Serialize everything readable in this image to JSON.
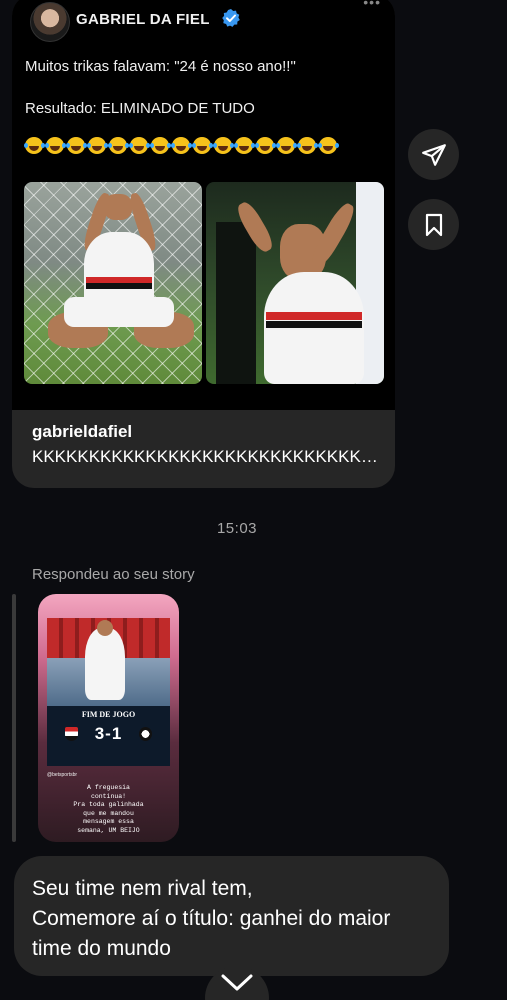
{
  "shared_post": {
    "author_name": "GABRIEL DA FIEL",
    "verified": true,
    "text_line1": "Muitos trikas falavam: \"24 é nosso ano!!\"",
    "text_line2": "Resultado: ELIMINADO DE TUDO",
    "emoji_icon": "laughing-tears-emoji",
    "emoji_count": 15,
    "username": "gabrieldafiel",
    "caption": "KKKKKKKKKKKKKKKKKKKKKKKKKKKKKKKKK"
  },
  "actions": {
    "share_icon": "send-icon",
    "save_icon": "bookmark-icon"
  },
  "timestamp": "15:03",
  "story_reply": {
    "label": "Respondeu ao seu story",
    "story": {
      "headline": "FIM DE JOGO",
      "score": "3-1",
      "handle": "@betsportsbr",
      "caption": "A freguesia\ncontinua!\nPra toda galinhada\nque me mandou\nmensagem essa\nsemana, UM BEIJO"
    }
  },
  "message": {
    "text": "Seu time nem rival tem,\nComemore aí o título: ganhei do maior\ntime do mundo"
  },
  "scroll_control": {
    "icon": "chevron-down-icon"
  },
  "colors": {
    "background": "#0b0c10",
    "bubble": "#262626",
    "muted_text": "#a8a8a8",
    "verified_blue": "#3897f0"
  }
}
